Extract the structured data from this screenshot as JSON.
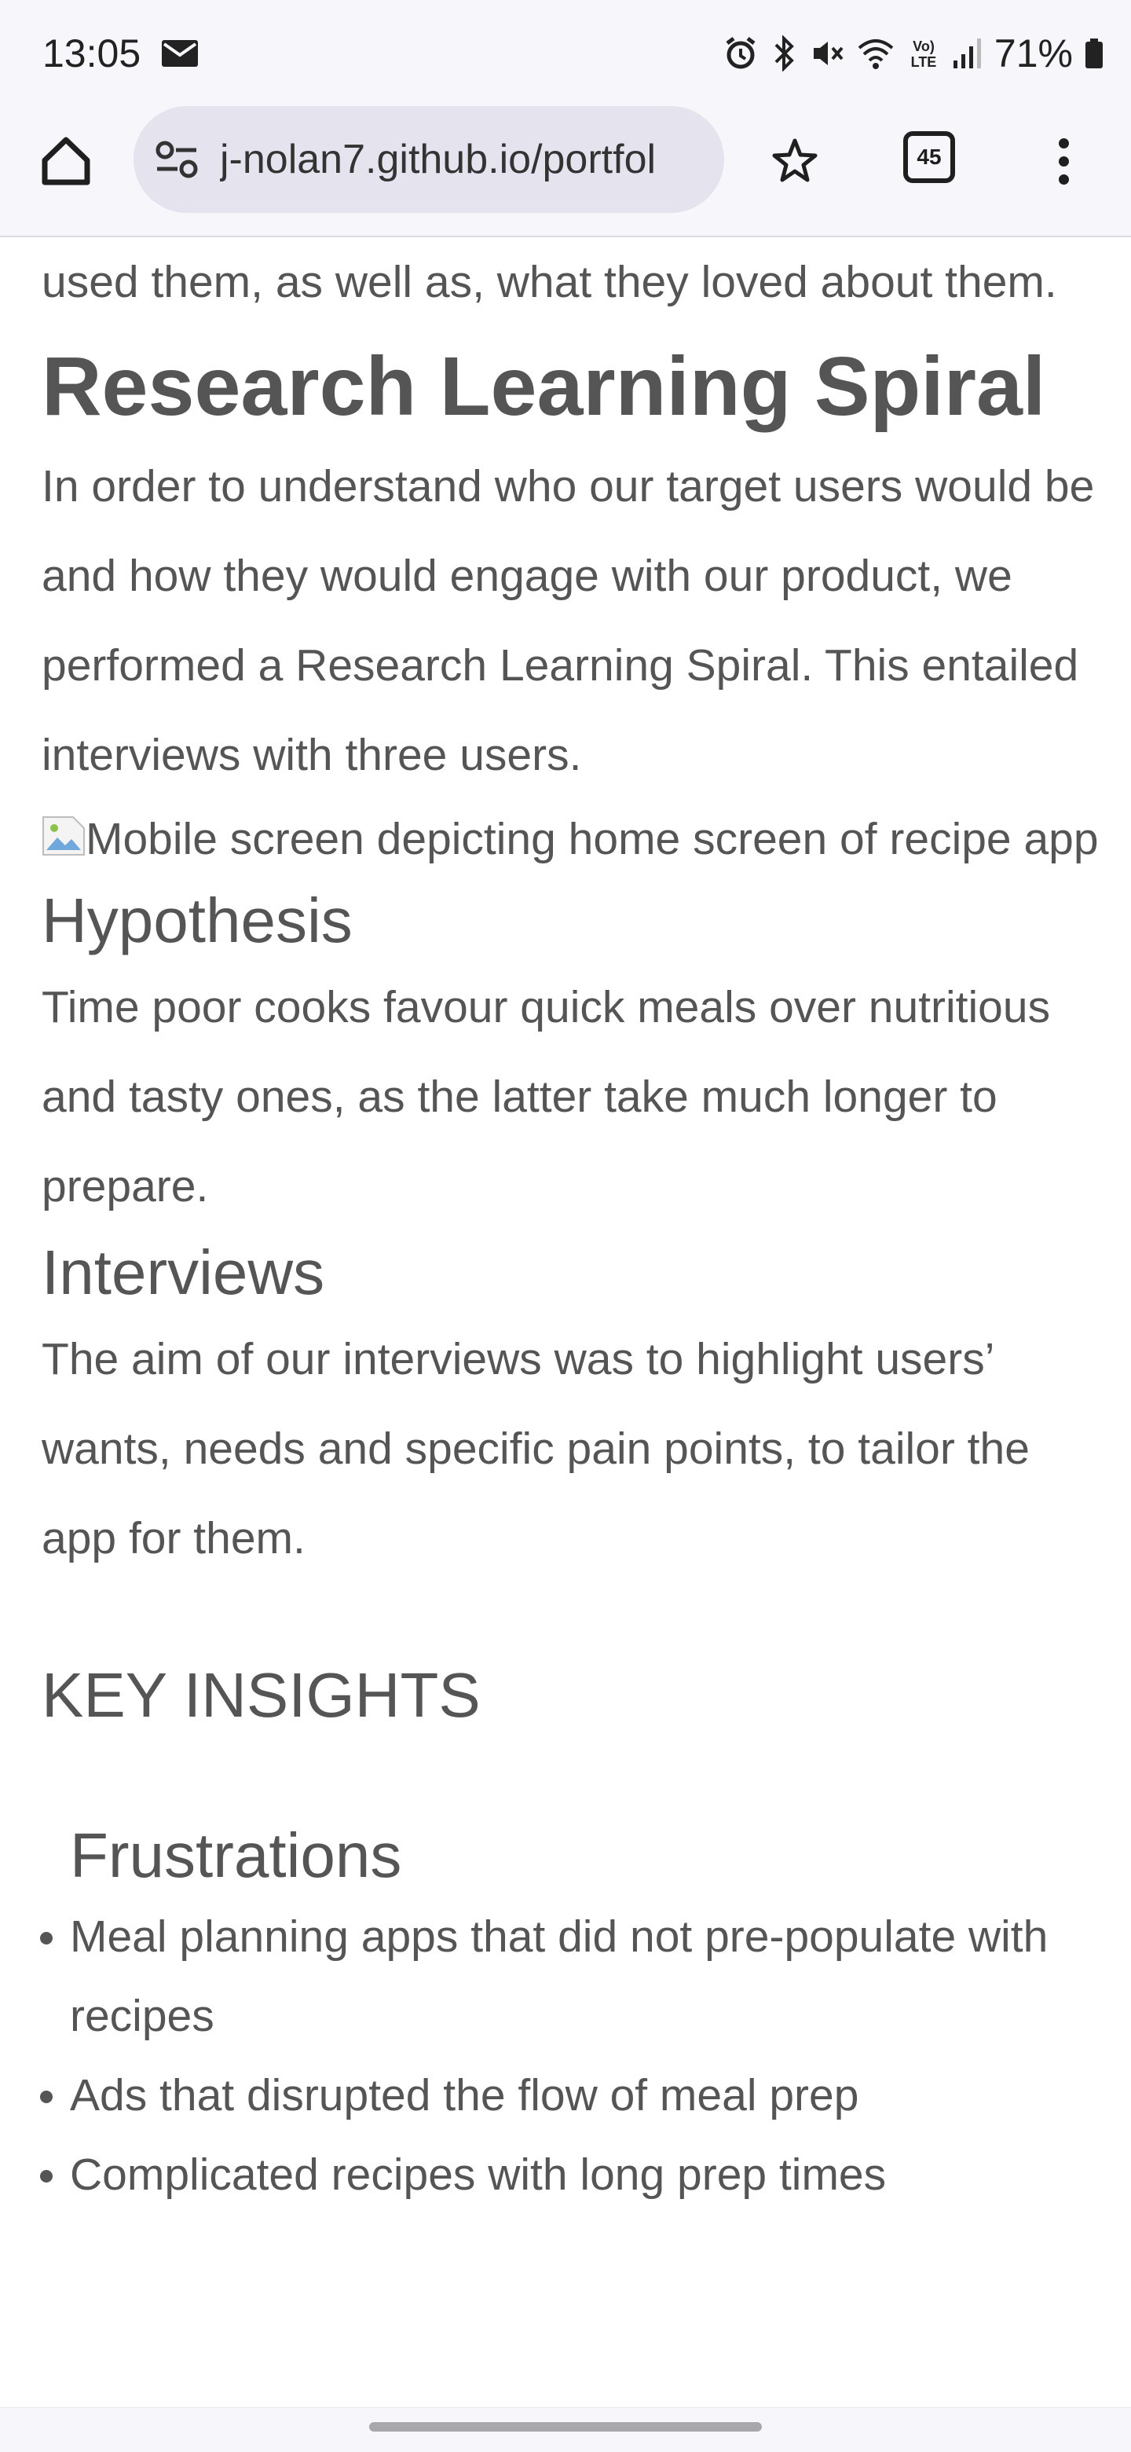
{
  "status_bar": {
    "time": "13:05",
    "battery": "71%",
    "icons": [
      "mail-icon",
      "alarm-icon",
      "bluetooth-icon",
      "mute-icon",
      "wifi-icon",
      "volte-icon",
      "signal-icon",
      "battery-icon"
    ]
  },
  "browser": {
    "url": "j-nolan7.github.io/portfol",
    "tab_count": "45"
  },
  "page": {
    "intro_text": "used them, as well as, what they loved about them.",
    "research_heading": "Research Learning Spiral",
    "research_text": "In order to understand who our target users would be and how they would engage with our product, we performed a Research Learning Spiral. This entailed interviews with three users.",
    "image_alt": "Mobile screen depicting home screen of recipe app",
    "hypothesis_heading": "Hypothesis",
    "hypothesis_text": "Time poor cooks favour quick meals over nutritious and tasty ones, as the latter take much longer to prepare.",
    "interviews_heading": "Interviews",
    "interviews_text": "The aim of our interviews was to highlight users’ wants, needs and specific pain points, to tailor the app for them.",
    "key_insights_heading": "KEY INSIGHTS",
    "frustrations_heading": "Frustrations",
    "frustrations": [
      "Meal planning apps that did not pre-populate with recipes",
      "Ads that disrupted the flow of meal prep",
      "Complicated recipes with long prep times"
    ]
  }
}
